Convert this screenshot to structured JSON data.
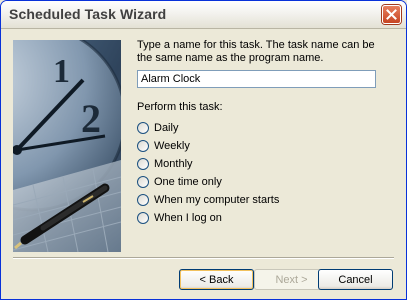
{
  "window": {
    "title": "Scheduled Task Wizard"
  },
  "instruction_text": "Type a name for this task.  The task name can be the same name as the program name.",
  "task_name_value": "Alarm Clock",
  "perform_label": "Perform this task:",
  "schedule_options": {
    "daily": "Daily",
    "weekly": "Weekly",
    "monthly": "Monthly",
    "one_time": "One time only",
    "computer_starts": "When my computer starts",
    "log_on": "When I log on"
  },
  "buttons": {
    "back": "< Back",
    "next": "Next >",
    "cancel": "Cancel"
  },
  "icons": {
    "close": "close-icon",
    "artwork": "clock-and-pen-illustration"
  },
  "colors": {
    "title_text": "#404040",
    "close_button": "#c64422",
    "dialog_bg": "#ece9d8",
    "input_border": "#7f9db9"
  }
}
